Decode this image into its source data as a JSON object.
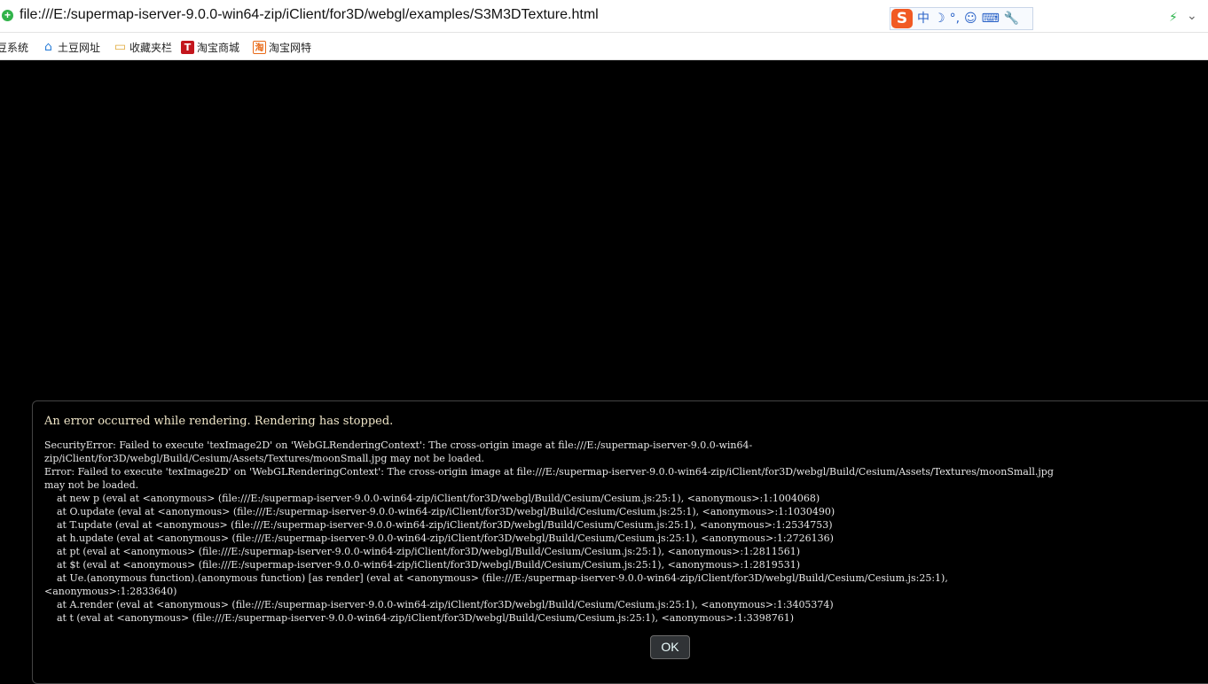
{
  "browser": {
    "url": "file:///E:/supermap-iserver-9.0.0-win64-zip/iClient/for3D/webgl/examples/S3M3DTexture.html",
    "ime_toolbar": {
      "logo": "S",
      "items": [
        "中",
        "☽",
        "°,",
        "☺",
        "⌨",
        "🔧"
      ]
    },
    "bookmarks": [
      {
        "label": "豆系统"
      },
      {
        "label": "土豆网址"
      },
      {
        "label": "收藏夹栏"
      },
      {
        "label": "淘宝商城",
        "badge": "T"
      },
      {
        "label": "淘宝网特",
        "badge": "淘"
      }
    ]
  },
  "error_dialog": {
    "title": "An error occurred while rendering. Rendering has stopped.",
    "message": "SecurityError: Failed to execute 'texImage2D' on 'WebGLRenderingContext': The cross-origin image at file:///E:/supermap-iserver-9.0.0-win64-\nzip/iClient/for3D/webgl/Build/Cesium/Assets/Textures/moonSmall.jpg may not be loaded.\nError: Failed to execute 'texImage2D' on 'WebGLRenderingContext': The cross-origin image at file:///E:/supermap-iserver-9.0.0-win64-zip/iClient/for3D/webgl/Build/Cesium/Assets/Textures/moonSmall.jpg\nmay not be loaded.\n    at new p (eval at <anonymous> (file:///E:/supermap-iserver-9.0.0-win64-zip/iClient/for3D/webgl/Build/Cesium/Cesium.js:25:1), <anonymous>:1:1004068)\n    at O.update (eval at <anonymous> (file:///E:/supermap-iserver-9.0.0-win64-zip/iClient/for3D/webgl/Build/Cesium/Cesium.js:25:1), <anonymous>:1:1030490)\n    at T.update (eval at <anonymous> (file:///E:/supermap-iserver-9.0.0-win64-zip/iClient/for3D/webgl/Build/Cesium/Cesium.js:25:1), <anonymous>:1:2534753)\n    at h.update (eval at <anonymous> (file:///E:/supermap-iserver-9.0.0-win64-zip/iClient/for3D/webgl/Build/Cesium/Cesium.js:25:1), <anonymous>:1:2726136)\n    at pt (eval at <anonymous> (file:///E:/supermap-iserver-9.0.0-win64-zip/iClient/for3D/webgl/Build/Cesium/Cesium.js:25:1), <anonymous>:1:2811561)\n    at $t (eval at <anonymous> (file:///E:/supermap-iserver-9.0.0-win64-zip/iClient/for3D/webgl/Build/Cesium/Cesium.js:25:1), <anonymous>:1:2819531)\n    at Ue.(anonymous function).(anonymous function) [as render] (eval at <anonymous> (file:///E:/supermap-iserver-9.0.0-win64-zip/iClient/for3D/webgl/Build/Cesium/Cesium.js:25:1),\n<anonymous>:1:2833640)\n    at A.render (eval at <anonymous> (file:///E:/supermap-iserver-9.0.0-win64-zip/iClient/for3D/webgl/Build/Cesium/Cesium.js:25:1), <anonymous>:1:3405374)\n    at t (eval at <anonymous> (file:///E:/supermap-iserver-9.0.0-win64-zip/iClient/for3D/webgl/Build/Cesium/Cesium.js:25:1), <anonymous>:1:3398761)",
    "ok_label": "OK"
  },
  "colors": {
    "viewport_background": "#000000",
    "secure_icon": "#31b34a",
    "ime_logo": "#f15a24"
  }
}
